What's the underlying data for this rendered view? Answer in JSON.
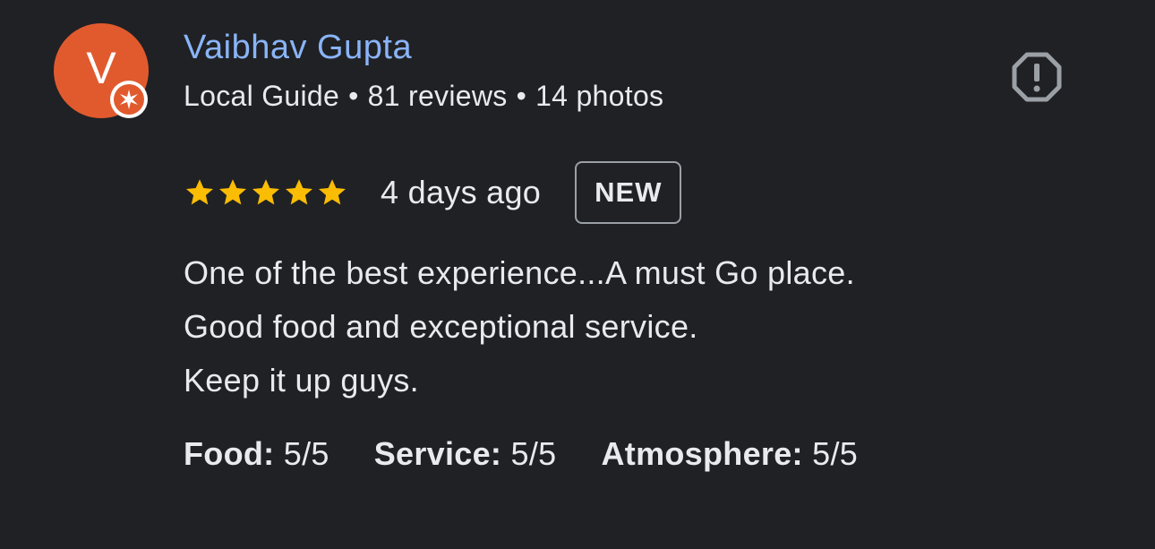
{
  "reviewer": {
    "initial": "V",
    "name": "Vaibhav Gupta",
    "badge_icon": "local-guide-star-icon",
    "meta": {
      "level": "Local Guide",
      "reviews": "81 reviews",
      "photos": "14 photos",
      "separator": "•"
    }
  },
  "review": {
    "rating": 5,
    "rating_max": 5,
    "date": "4 days ago",
    "badge": "NEW",
    "text_lines": [
      "One of the best experience...A must Go place.",
      "Good food and exceptional service.",
      "Keep it up guys."
    ],
    "attributes": [
      {
        "label": "Food:",
        "value": "5/5"
      },
      {
        "label": "Service:",
        "value": "5/5"
      },
      {
        "label": "Atmosphere:",
        "value": "5/5"
      }
    ]
  },
  "actions": {
    "report_icon": "report-octagon-icon"
  },
  "colors": {
    "background": "#202124",
    "avatar": "#e15a2e",
    "name": "#8ab4f8",
    "star": "#fbbc04",
    "text": "#e8eaed",
    "muted": "#9aa0a6"
  }
}
